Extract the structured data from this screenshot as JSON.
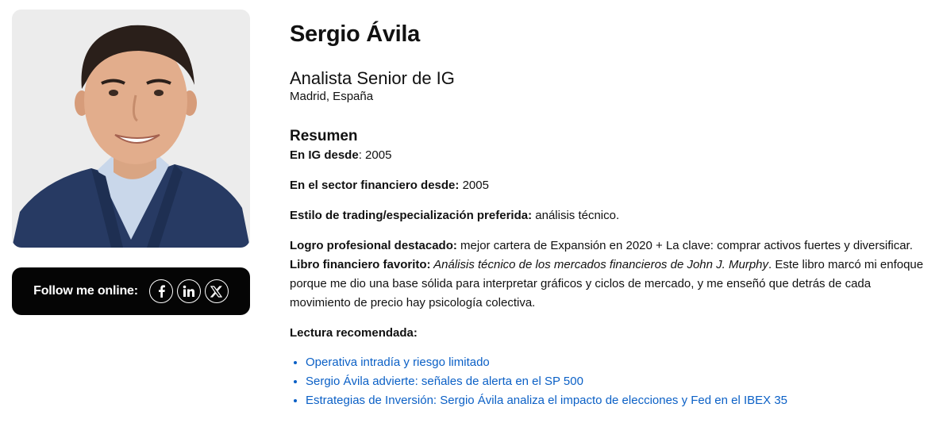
{
  "profile": {
    "name": "Sergio Ávila",
    "role": "Analista Senior de IG",
    "location": "Madrid, España"
  },
  "social": {
    "label": "Follow me online:",
    "icons": [
      "facebook-icon",
      "linkedin-icon",
      "x-icon"
    ]
  },
  "summary": {
    "title": "Resumen",
    "ig_since": {
      "label": "En IG desde",
      "value": ": 2005"
    },
    "sector_since": {
      "label": "En el sector financiero desde:",
      "value": " 2005"
    },
    "style": {
      "label": "Estilo de trading/especialización preferida:",
      "value": " análisis técnico."
    },
    "achievement": {
      "label": "Logro profesional destacado:",
      "value": " mejor cartera de Expansión en 2020 + La clave: comprar activos fuertes y diversificar."
    },
    "book": {
      "label": "Libro financiero favorito:",
      "title": " Análisis técnico de los mercados financieros de John J. Murphy",
      "text": ". Este libro marcó mi enfoque porque me dio una base sólida para interpretar gráficos y ciclos de mercado, y me enseñó que detrás de cada movimiento de precio hay psicología colectiva."
    },
    "reading_label": "Lectura recomendada:",
    "reading": [
      "Operativa intradía y riesgo limitado",
      "Sergio Ávila advierte: señales de alerta en el SP 500",
      "Estrategias de Inversión: Sergio Ávila analiza el impacto de elecciones y Fed en el IBEX 35"
    ]
  },
  "colors": {
    "link": "#0b60c6",
    "social_bar": "#050505"
  }
}
